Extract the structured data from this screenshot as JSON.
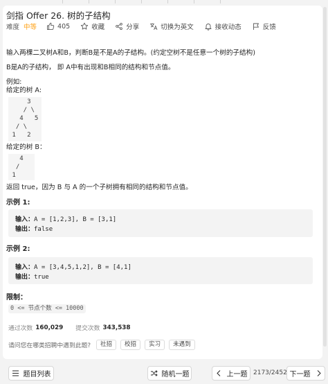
{
  "problem": {
    "title": "剑指 Offer 26. 树的子结构",
    "difficulty_label": "难度",
    "difficulty": "中等",
    "likes": "405",
    "favorite": "收藏",
    "share": "分享",
    "switch_lang": "切换为英文",
    "notify": "接收动态",
    "feedback": "反馈"
  },
  "description": {
    "p1": "输入两棵二叉树A和B，判断B是不是A的子结构。(约定空树不是任意一个树的子结构)",
    "p2": "B是A的子结构， 即 A中有出现和B相同的结构和节点值。",
    "example_heading": "例如:",
    "tree_a_label": "给定的树 A:",
    "tree_a": [
      "     3",
      "    / \\",
      "   4   5",
      "  / \\",
      " 1   2"
    ],
    "tree_b_label": "给定的树 B：",
    "tree_b": [
      "   4",
      "  /",
      " 1"
    ],
    "conclusion": "返回 true，因为 B 与 A 的一个子树拥有相同的结构和节点值。"
  },
  "examples": [
    {
      "title": "示例 1:",
      "input_label": "输入：",
      "input_value": "A = [1,2,3], B = [3,1]",
      "output_label": "输出：",
      "output_value": "false"
    },
    {
      "title": "示例 2:",
      "input_label": "输入：",
      "input_value": "A = [3,4,5,1,2], B = [4,1]",
      "output_label": "输出：",
      "output_value": "true"
    }
  ],
  "limits": {
    "title": "限制：",
    "text": "0 <= 节点个数 <= 10000"
  },
  "stats": {
    "passed_label": "通过次数",
    "passed": "160,029",
    "submitted_label": "提交次数",
    "submitted": "343,538"
  },
  "interview": {
    "question": "请问您在哪类招聘中遇到此题?",
    "tags": [
      "社招",
      "校招",
      "实习",
      "未遇到"
    ]
  },
  "bottom": {
    "list": "题目列表",
    "random": "随机一题",
    "prev": "上一题",
    "pager": "2173/2452",
    "next": "下一题"
  },
  "colors": {
    "difficulty_medium": "#ffa116",
    "panel_bg": "#ffffff",
    "page_bg": "#f3f3f3"
  },
  "icons": {
    "likes": "thumbs-up-icon",
    "favorite": "star-icon",
    "share": "share-icon",
    "switch_lang": "translate-icon",
    "notify": "bell-icon",
    "feedback": "flag-icon",
    "list": "list-icon",
    "random": "shuffle-icon",
    "prev": "chevron-left-icon",
    "next": "chevron-right-icon"
  }
}
